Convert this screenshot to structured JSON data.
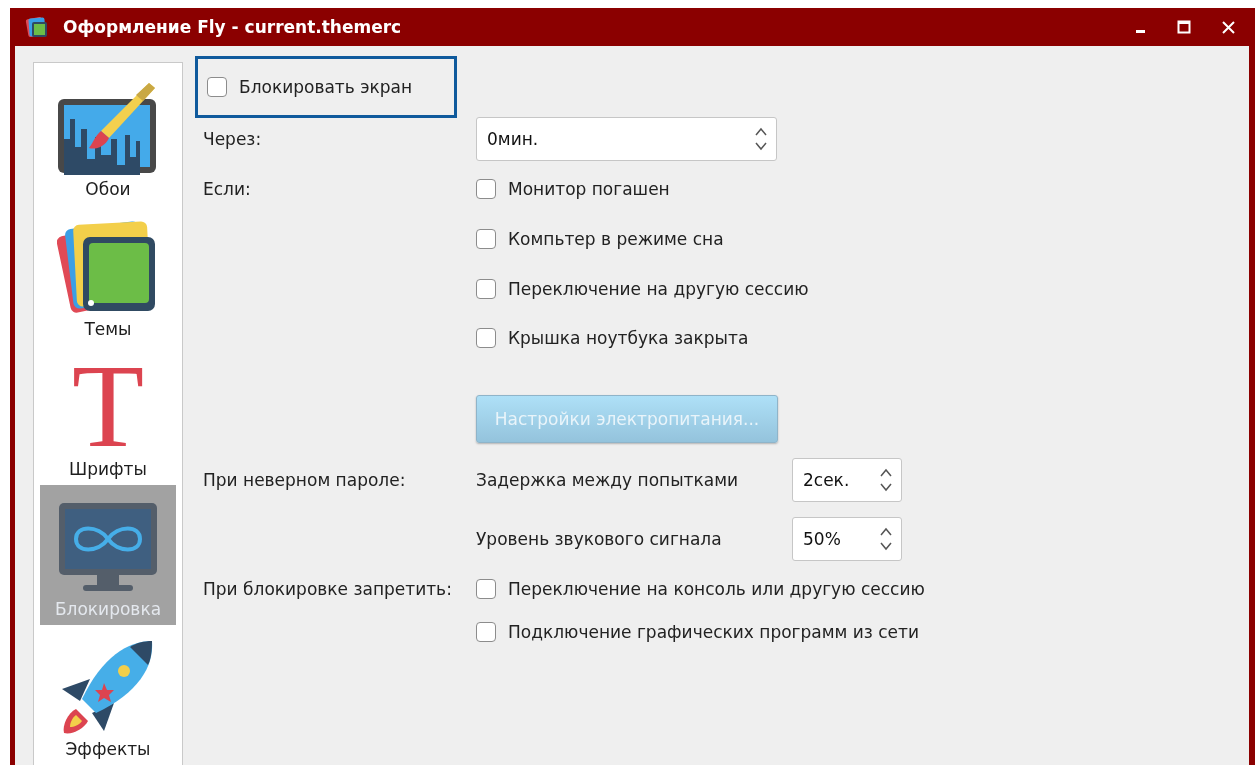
{
  "window": {
    "title": "Оформление Fly - current.themerc"
  },
  "sidebar": {
    "items": [
      {
        "kind": "wallpaper",
        "label": "Обои",
        "selected": false
      },
      {
        "kind": "themes",
        "label": "Темы",
        "selected": false
      },
      {
        "kind": "fonts",
        "glyph": "T",
        "label": "Шрифты",
        "selected": false
      },
      {
        "kind": "lock",
        "label": "Блокировка",
        "selected": true
      },
      {
        "kind": "effects",
        "label": "Эффекты",
        "selected": false
      }
    ]
  },
  "lock_screen": {
    "label": "Блокировать экран",
    "checked": false,
    "focused": true
  },
  "delay": {
    "label": "Через:",
    "value": "0мин."
  },
  "conditions": {
    "label": "Если:",
    "options": [
      {
        "label": "Монитор погашен",
        "checked": false
      },
      {
        "label": "Компьтер в режиме сна",
        "checked": false
      },
      {
        "label": "Переключение на другую сессию",
        "checked": false
      },
      {
        "label": "Крышка ноутбука закрыта",
        "checked": false
      }
    ]
  },
  "power_button": {
    "label": "Настройки электропитания...",
    "disabled": true
  },
  "wrong_password": {
    "label": "При неверном пароле:",
    "settings": [
      {
        "label": "Задержка между попытками",
        "value": "2сек."
      },
      {
        "label": "Уровень звукового сигнала",
        "value": "50%"
      }
    ]
  },
  "forbid": {
    "label": "При блокировке запретить:",
    "options": [
      {
        "label": "Переключение на консоль или другую сессию",
        "checked": false
      },
      {
        "label": "Подключение графических программ из сети",
        "checked": false
      }
    ]
  }
}
